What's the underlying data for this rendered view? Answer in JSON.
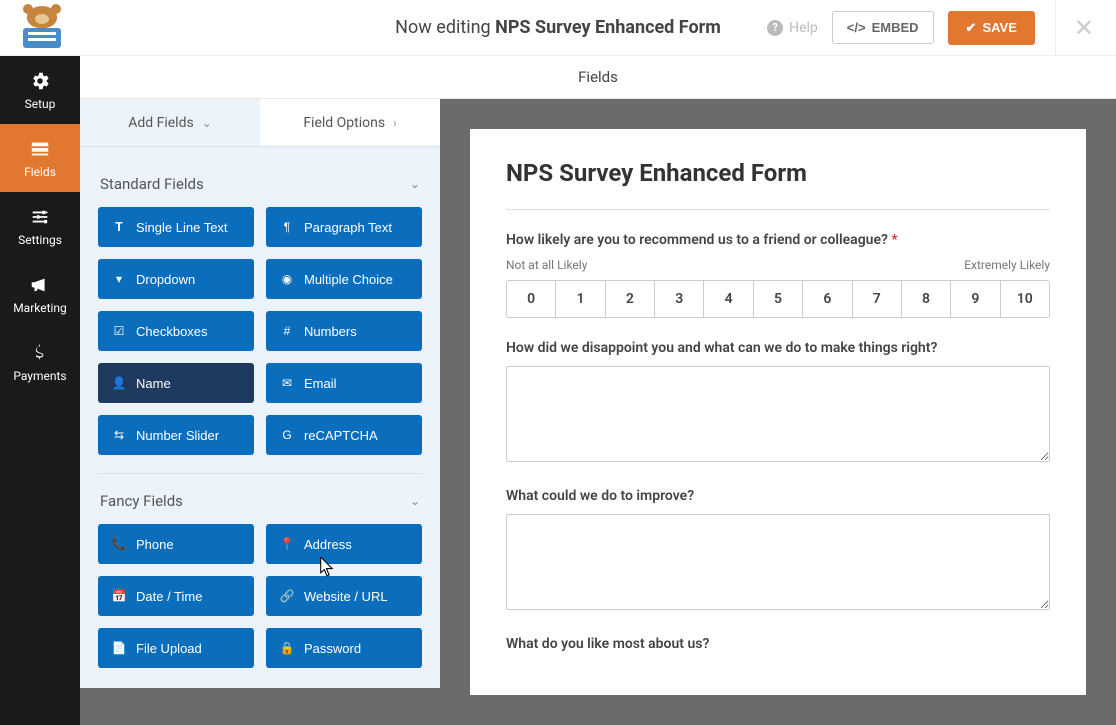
{
  "header": {
    "editing_prefix": "Now editing ",
    "form_name": "NPS Survey Enhanced Form",
    "help": "Help",
    "embed": "EMBED",
    "save": "SAVE"
  },
  "rail": [
    {
      "key": "setup",
      "label": "Setup"
    },
    {
      "key": "fields",
      "label": "Fields"
    },
    {
      "key": "settings",
      "label": "Settings"
    },
    {
      "key": "marketing",
      "label": "Marketing"
    },
    {
      "key": "payments",
      "label": "Payments"
    }
  ],
  "panel_tabs": {
    "add": "Add Fields",
    "options": "Field Options"
  },
  "canvas_tab": "Fields",
  "sections": {
    "standard": {
      "title": "Standard Fields",
      "items": [
        {
          "icon": "text-icon",
          "label": "Single Line Text"
        },
        {
          "icon": "paragraph-icon",
          "label": "Paragraph Text"
        },
        {
          "icon": "dropdown-icon",
          "label": "Dropdown"
        },
        {
          "icon": "radio-icon",
          "label": "Multiple Choice"
        },
        {
          "icon": "checkbox-icon",
          "label": "Checkboxes"
        },
        {
          "icon": "hash-icon",
          "label": "Numbers"
        },
        {
          "icon": "user-icon",
          "label": "Name",
          "hover": true
        },
        {
          "icon": "mail-icon",
          "label": "Email"
        },
        {
          "icon": "slider-icon",
          "label": "Number Slider"
        },
        {
          "icon": "recaptcha-icon",
          "label": "reCAPTCHA"
        }
      ]
    },
    "fancy": {
      "title": "Fancy Fields",
      "items": [
        {
          "icon": "phone-icon",
          "label": "Phone"
        },
        {
          "icon": "pin-icon",
          "label": "Address"
        },
        {
          "icon": "calendar-icon",
          "label": "Date / Time"
        },
        {
          "icon": "link-icon",
          "label": "Website / URL"
        },
        {
          "icon": "file-icon",
          "label": "File Upload"
        },
        {
          "icon": "lock-icon",
          "label": "Password"
        }
      ]
    }
  },
  "form": {
    "title": "NPS Survey Enhanced Form",
    "q1": {
      "label": "How likely are you to recommend us to a friend or colleague?",
      "low": "Not at all Likely",
      "high": "Extremely Likely",
      "scale": [
        "0",
        "1",
        "2",
        "3",
        "4",
        "5",
        "6",
        "7",
        "8",
        "9",
        "10"
      ]
    },
    "q2": "How did we disappoint you and what can we do to make things right?",
    "q3": "What could we do to improve?",
    "q4": "What do you like most about us?"
  }
}
